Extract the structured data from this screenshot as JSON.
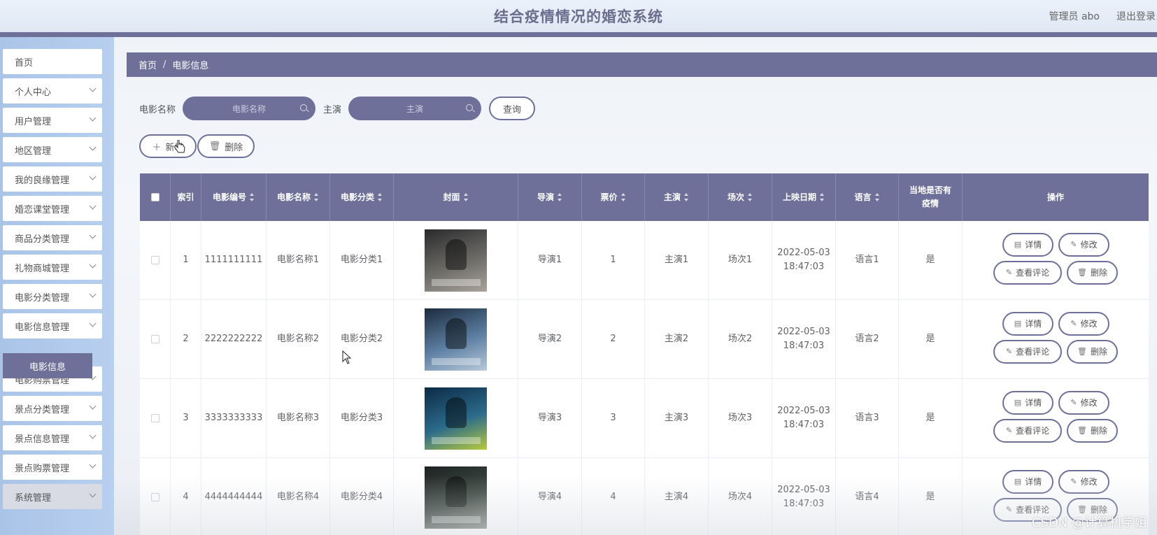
{
  "header": {
    "title": "结合疫情情况的婚恋系统",
    "user": "管理员 abo",
    "logout": "退出登录"
  },
  "sidebar": {
    "items": [
      {
        "label": "首页",
        "expandable": false
      },
      {
        "label": "个人中心",
        "expandable": true
      },
      {
        "label": "用户管理",
        "expandable": true
      },
      {
        "label": "地区管理",
        "expandable": true
      },
      {
        "label": "我的良缘管理",
        "expandable": true
      },
      {
        "label": "婚恋课堂管理",
        "expandable": true
      },
      {
        "label": "商品分类管理",
        "expandable": true
      },
      {
        "label": "礼物商城管理",
        "expandable": true
      },
      {
        "label": "电影分类管理",
        "expandable": true
      },
      {
        "label": "电影信息管理",
        "expandable": true
      },
      {
        "label": "电影购票管理",
        "expandable": true
      },
      {
        "label": "景点分类管理",
        "expandable": true
      },
      {
        "label": "景点信息管理",
        "expandable": true
      },
      {
        "label": "景点购票管理",
        "expandable": true
      },
      {
        "label": "系统管理",
        "expandable": true
      }
    ],
    "active_sub": "电影信息"
  },
  "breadcrumb": {
    "home": "首页",
    "sep": "/",
    "current": "电影信息"
  },
  "search": {
    "name_label": "电影名称",
    "name_placeholder": "电影名称",
    "actor_label": "主演",
    "actor_placeholder": "主演",
    "query": "查询"
  },
  "toolbar": {
    "add": "新增",
    "delete": "删除"
  },
  "table": {
    "columns": [
      "索引",
      "电影编号",
      "电影名称",
      "电影分类",
      "封面",
      "导演",
      "票价",
      "主演",
      "场次",
      "上映日期",
      "语言",
      "当地是否有疫情",
      "操作"
    ],
    "rows": [
      {
        "index": "1",
        "code": "1111111111",
        "name": "电影名称1",
        "category": "电影分类1",
        "director": "导演1",
        "price": "1",
        "actor": "主演1",
        "session": "场次1",
        "date": "2022-05-03",
        "time": "18:47:03",
        "language": "语言1",
        "epidemic": "是"
      },
      {
        "index": "2",
        "code": "2222222222",
        "name": "电影名称2",
        "category": "电影分类2",
        "director": "导演2",
        "price": "2",
        "actor": "主演2",
        "session": "场次2",
        "date": "2022-05-03",
        "time": "18:47:03",
        "language": "语言2",
        "epidemic": "是"
      },
      {
        "index": "3",
        "code": "3333333333",
        "name": "电影名称3",
        "category": "电影分类3",
        "director": "导演3",
        "price": "3",
        "actor": "主演3",
        "session": "场次3",
        "date": "2022-05-03",
        "time": "18:47:03",
        "language": "语言3",
        "epidemic": "是"
      },
      {
        "index": "4",
        "code": "4444444444",
        "name": "电影名称4",
        "category": "电影分类4",
        "director": "导演4",
        "price": "4",
        "actor": "主演4",
        "session": "场次4",
        "date": "2022-05-03",
        "time": "18:47:03",
        "language": "语言4",
        "epidemic": "是"
      }
    ],
    "actions": {
      "detail": "详情",
      "edit": "修改",
      "comments": "查看评论",
      "delete": "删除"
    }
  },
  "watermark": "CSDN @计算机学姐",
  "colors": {
    "accent": "#6e7099",
    "sidebar": "#b8cfef"
  }
}
